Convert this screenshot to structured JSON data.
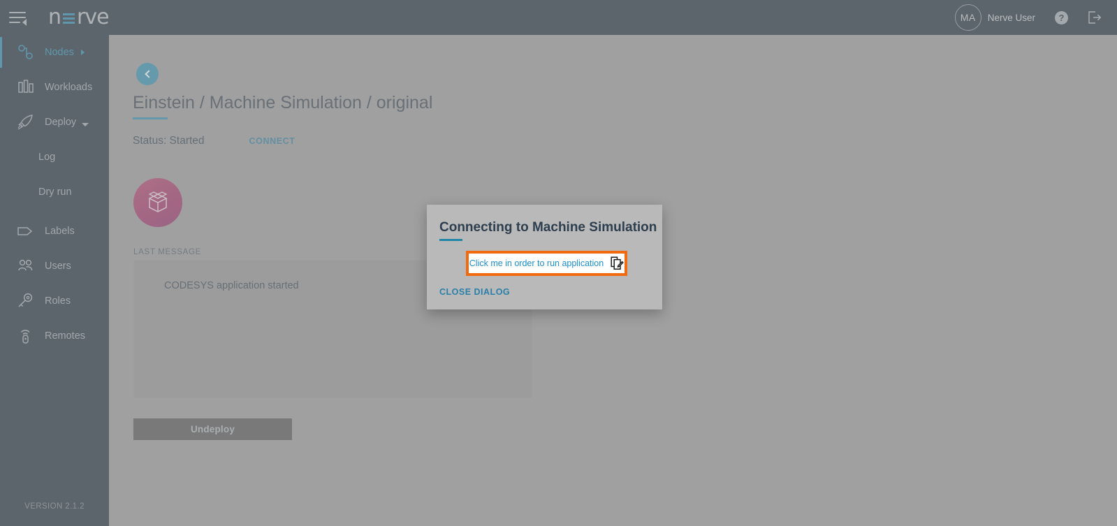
{
  "topbar": {
    "menu_icon": "hamburger-collapse-icon",
    "logo_left": "n",
    "logo_right": "rve",
    "avatar_initials": "MA",
    "username": "Nerve User",
    "help_icon": "?",
    "help_icon_name": "help-icon",
    "logout_icon_name": "logout-icon",
    "background": "#56616b"
  },
  "sidebar": {
    "version": "VERSION 2.1.2",
    "accent": "#5aa7c4",
    "items": [
      {
        "label": "Nodes",
        "icon": "nodes-icon",
        "active": true,
        "caret": "right"
      },
      {
        "label": "Workloads",
        "icon": "workloads-icon",
        "active": false,
        "caret": "none"
      },
      {
        "label": "Deploy",
        "icon": "deploy-icon",
        "active": false,
        "caret": "down"
      },
      {
        "label": "Log",
        "icon": "none",
        "active": false,
        "caret": "none",
        "sub": true
      },
      {
        "label": "Dry run",
        "icon": "none",
        "active": false,
        "caret": "none",
        "sub": true
      },
      {
        "label": "Labels",
        "icon": "labels-icon",
        "active": false,
        "caret": "none"
      },
      {
        "label": "Users",
        "icon": "users-icon",
        "active": false,
        "caret": "none"
      },
      {
        "label": "Roles",
        "icon": "roles-icon",
        "active": false,
        "caret": "none"
      },
      {
        "label": "Remotes",
        "icon": "remotes-icon",
        "active": false,
        "caret": "none"
      }
    ]
  },
  "main": {
    "back_button_icon": "chevron-left-icon",
    "page_title": "Einstein / Machine Simulation / original",
    "status": "Status: Started",
    "connect_label": "CONNECT",
    "workload_icon": "package-box-icon",
    "last_message_label": "LAST MESSAGE",
    "last_message_text": "CODESYS application started",
    "undeploy_label": "Undeploy",
    "accent": "#5fa7bf"
  },
  "dialog": {
    "title": "Connecting to Machine Simulation",
    "run_app_label": "Click me in order to run application",
    "run_app_icon": "copy-edit-icon",
    "close_label": "CLOSE DIALOG",
    "highlight_color": "#f26a10",
    "link_color": "#1a8fd0"
  }
}
